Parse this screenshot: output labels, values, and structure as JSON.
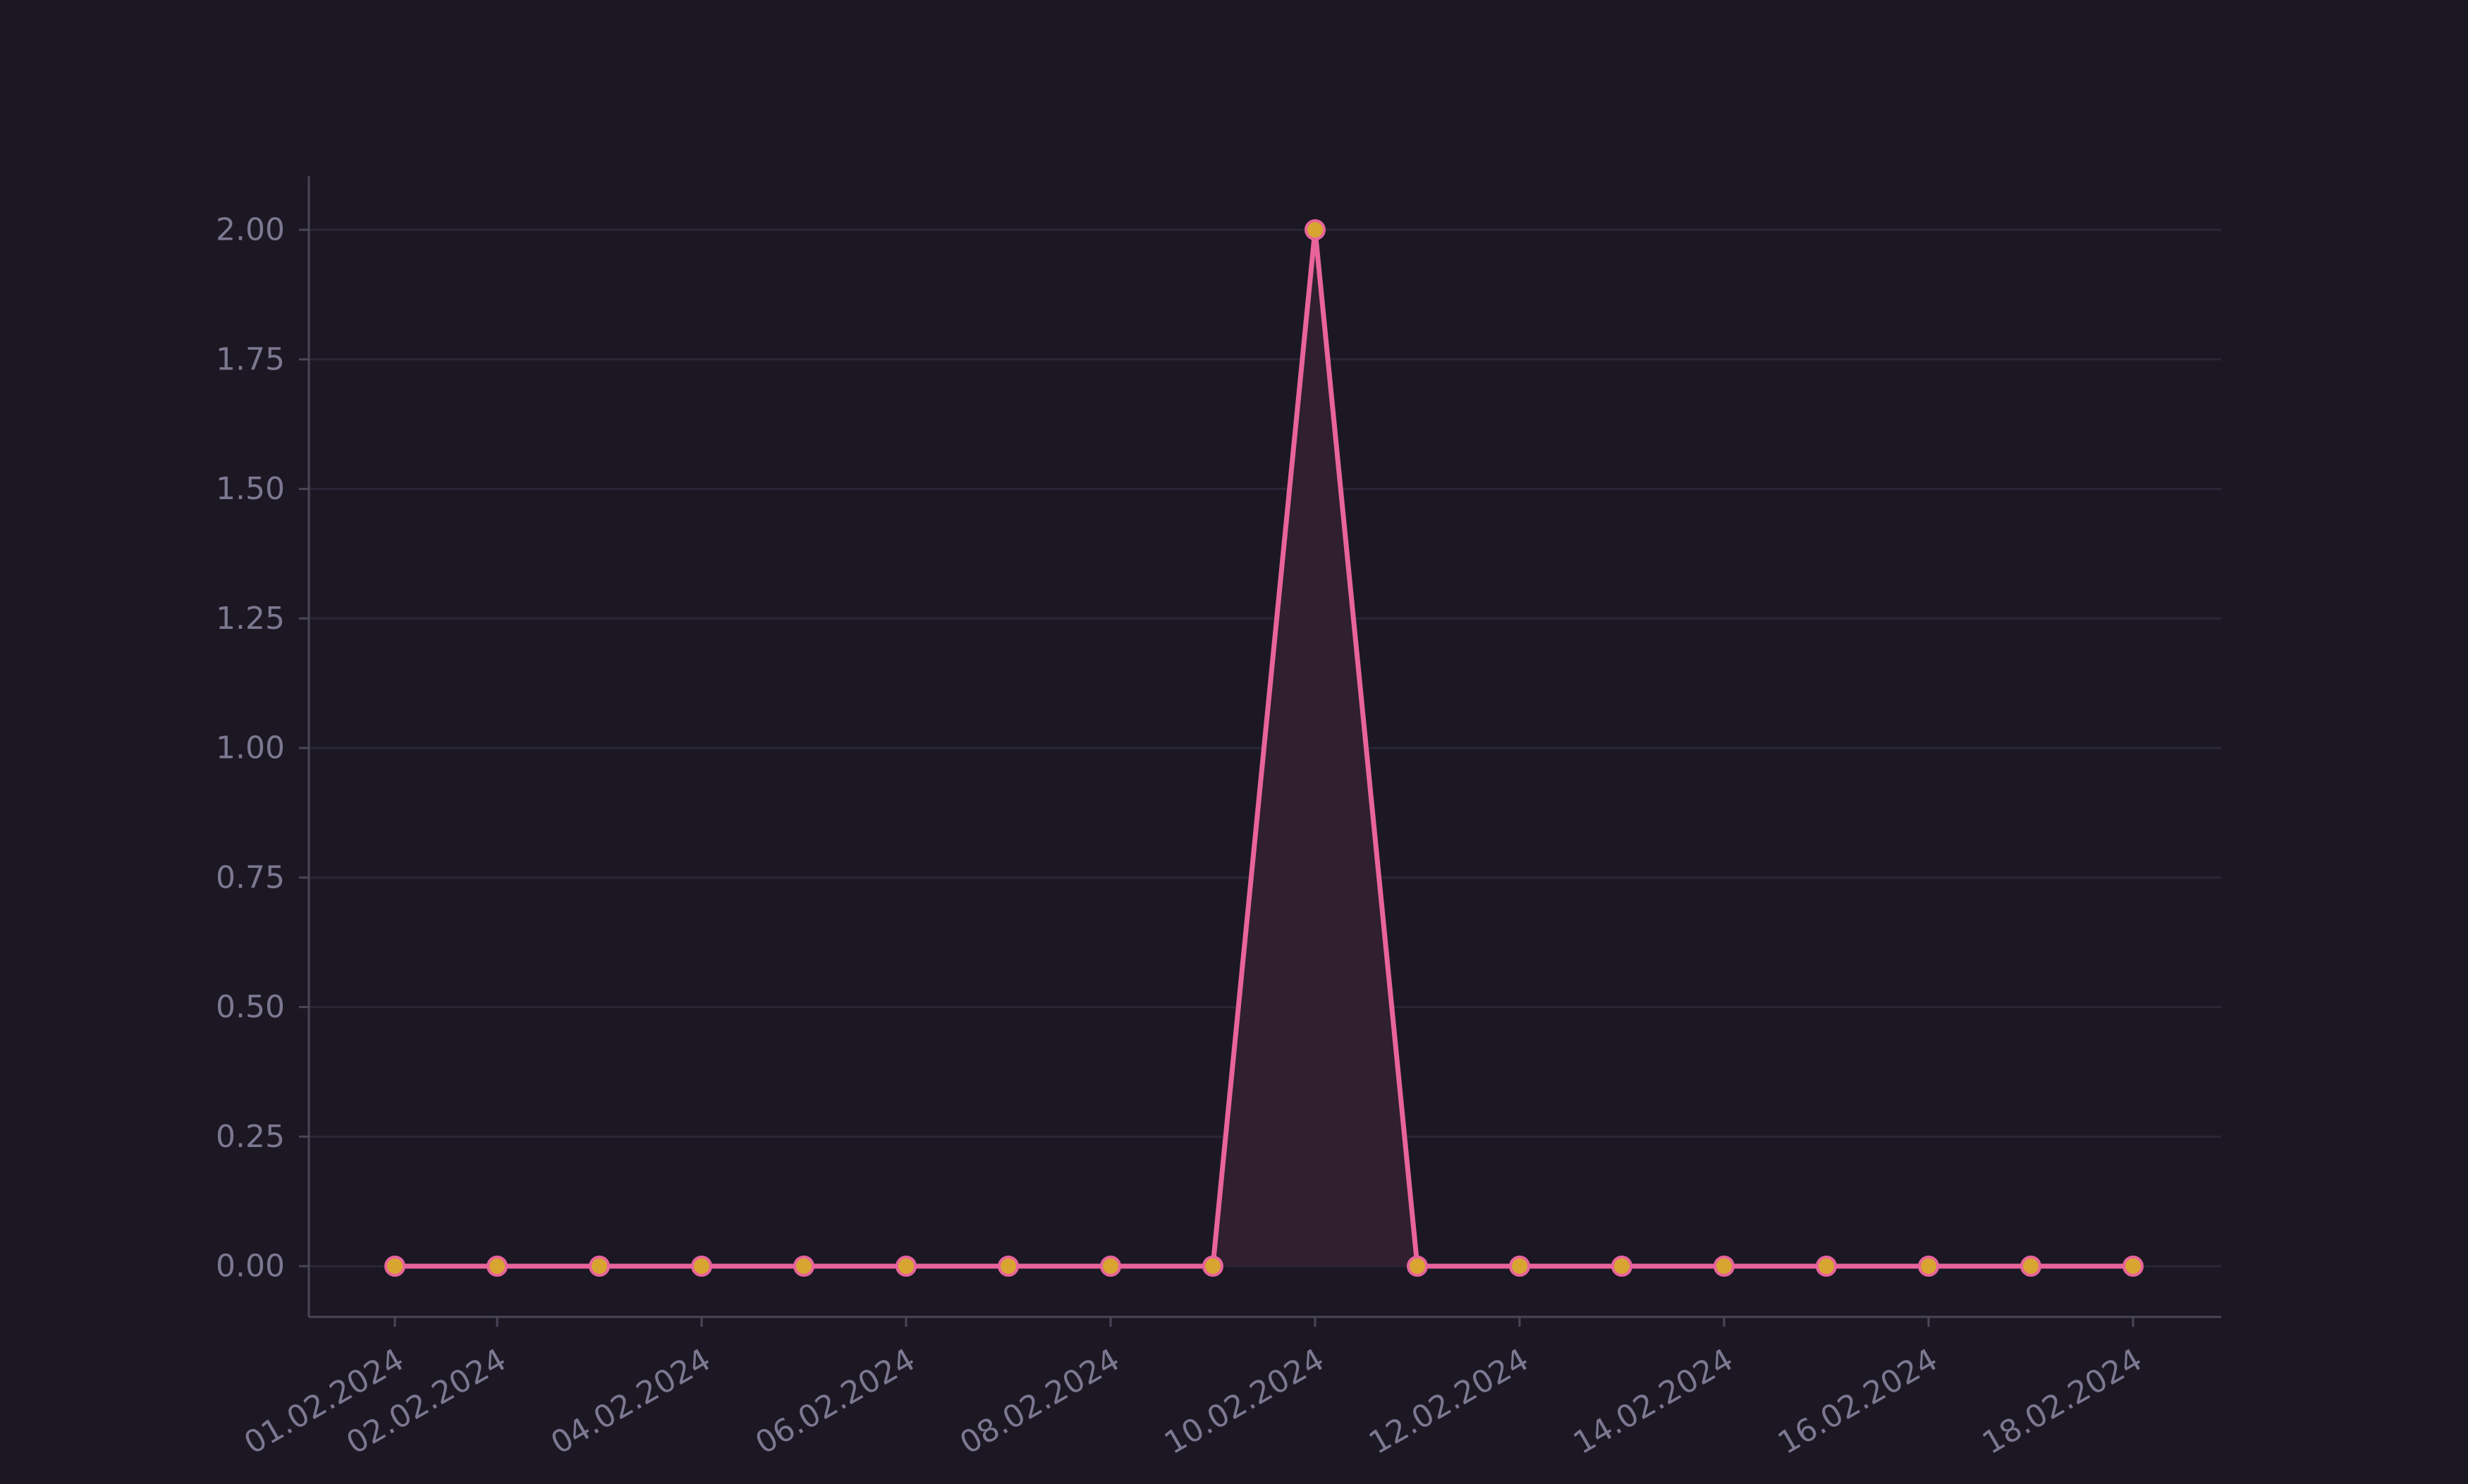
{
  "colors": {
    "background": "#1b1824",
    "grid": "#2a2636",
    "axis": "#4a4658",
    "tick_text": "#7d7891",
    "line": "#e8649a",
    "fill": "#2f1f2f",
    "marker_fill": "#d8a531",
    "marker_edge": "#e8649a"
  },
  "chart_data": {
    "type": "line",
    "title": "",
    "xlabel": "",
    "ylabel": "",
    "x": [
      "2024-02-01",
      "2024-02-02",
      "2024-02-03",
      "2024-02-04",
      "2024-02-05",
      "2024-02-06",
      "2024-02-07",
      "2024-02-08",
      "2024-02-09",
      "2024-02-10",
      "2024-02-11",
      "2024-02-12",
      "2024-02-13",
      "2024-02-14",
      "2024-02-15",
      "2024-02-16",
      "2024-02-17",
      "2024-02-18"
    ],
    "series": [
      {
        "values": [
          0,
          0,
          0,
          0,
          0,
          0,
          0,
          0,
          0,
          2,
          0,
          0,
          0,
          0,
          0,
          0,
          0,
          0
        ],
        "filled_area": true,
        "markers": true
      }
    ],
    "ylim": [
      -0.1,
      2.1
    ],
    "y_ticks": [
      "0.00",
      "0.25",
      "0.50",
      "0.75",
      "1.00",
      "1.25",
      "1.50",
      "1.75",
      "2.00"
    ],
    "x_ticks": [
      "2024-02-01",
      "2024-02-02",
      "2024-02-04",
      "2024-02-06",
      "2024-02-08",
      "2024-02-10",
      "2024-02-12",
      "2024-02-14",
      "2024-02-16",
      "2024-02-18"
    ],
    "x_tick_labels": [
      "01.02.2024",
      "02.02.2024",
      "04.02.2024",
      "06.02.2024",
      "08.02.2024",
      "10.02.2024",
      "12.02.2024",
      "14.02.2024",
      "16.02.2024",
      "18.02.2024"
    ],
    "grid": "horizontal",
    "legend": "none"
  }
}
